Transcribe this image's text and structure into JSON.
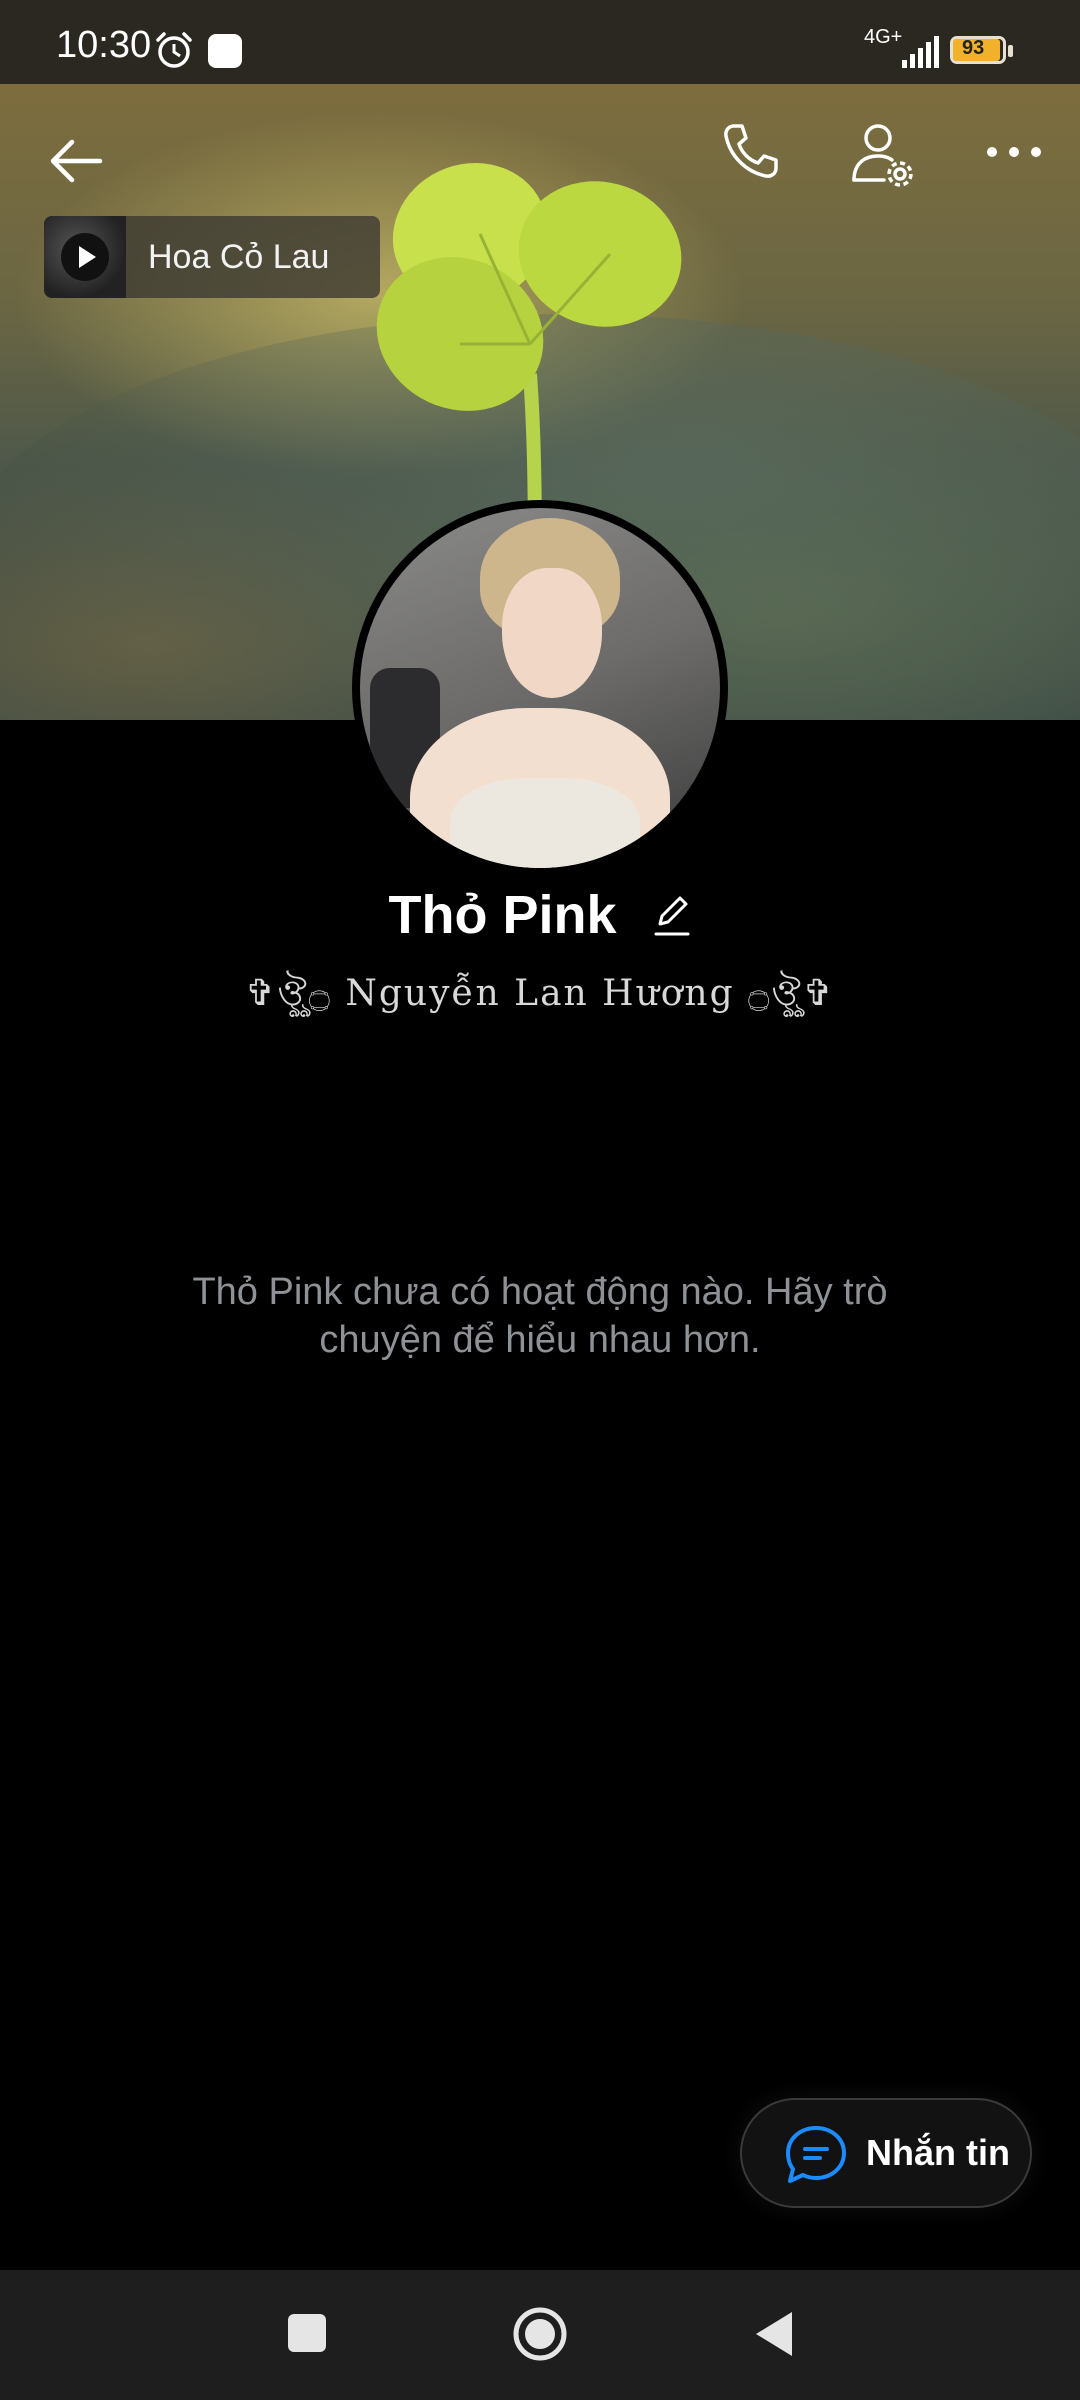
{
  "status_bar": {
    "time": "10:30",
    "network": "4G+",
    "battery": "93",
    "battery_level": 0.93
  },
  "music": {
    "title": "Hoa Cỏ Lau"
  },
  "profile": {
    "display_name": "Thỏ Pink",
    "real_name": "✞ঔৣ۝ Nguyễn Lan Hương ۝ঔৣ✞",
    "empty_message": "Thỏ Pink chưa có hoạt động nào. Hãy trò chuyện để hiểu nhau hơn."
  },
  "actions": {
    "message_label": "Nhắn tin"
  },
  "colors": {
    "accent": "#1a8cff",
    "background": "#000000",
    "muted_text": "#8e9296"
  }
}
